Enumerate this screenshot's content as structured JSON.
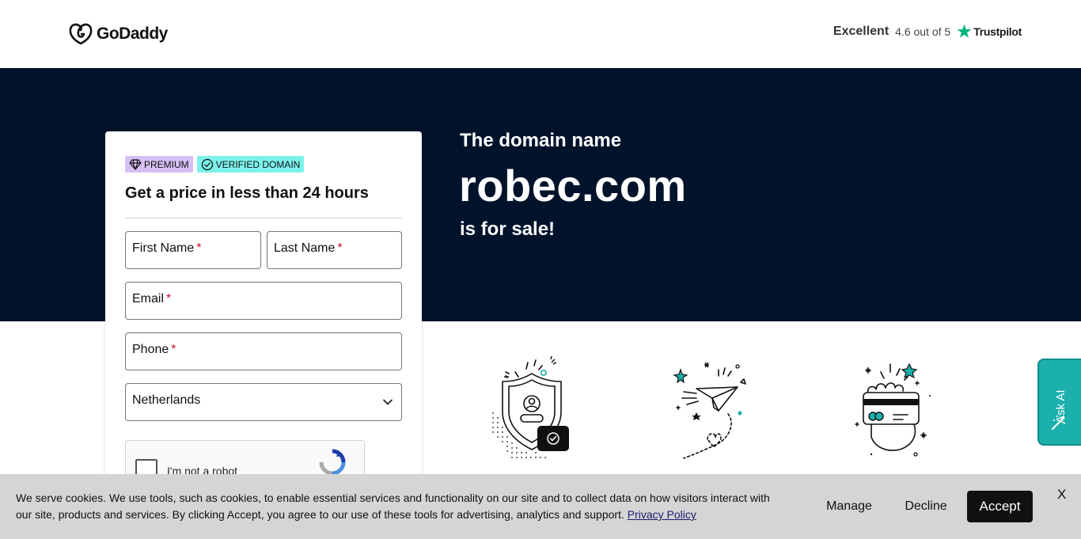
{
  "header": {
    "brand": "GoDaddy",
    "trust_label": "Excellent",
    "trust_rating": "4.6 out of 5",
    "trust_brand": "Trustpilot"
  },
  "hero": {
    "intro": "The domain name",
    "domain": "robec.com",
    "tagline": "is for sale!"
  },
  "form": {
    "badge_premium": "PREMIUM",
    "badge_verified": "VERIFIED DOMAIN",
    "title": "Get a price in less than 24 hours",
    "first_name_label": "First Name",
    "last_name_label": "Last Name",
    "email_label": "Email",
    "phone_label": "Phone",
    "required_mark": "*",
    "country_value": "Netherlands",
    "captcha_label": "I'm not a robot"
  },
  "ask_ai": {
    "label": "Ask AI"
  },
  "cookie": {
    "text": "We serve cookies. We use tools, such as cookies, to enable essential services and functionality on our site and to collect data on how visitors interact with our site, products and services. By clicking Accept, you agree to our use of these tools for advertising, analytics and support.",
    "policy_link": "Privacy Policy",
    "manage_label": "Manage",
    "decline_label": "Decline",
    "accept_label": "Accept",
    "close_label": "X"
  },
  "colors": {
    "hero_bg": "#00132b",
    "accent_teal": "#1bb0ac",
    "trustpilot_green": "#00b67a",
    "premium_badge": "#d6bff5",
    "verified_badge": "#7cf2ea"
  },
  "icons": [
    "godaddy-logo-icon",
    "trustpilot-star-icon",
    "diamond-icon",
    "check-circle-icon",
    "chevron-down-icon",
    "recaptcha-icon",
    "shield-user-icon",
    "paper-plane-icon",
    "hand-card-icon",
    "magic-wand-icon"
  ]
}
